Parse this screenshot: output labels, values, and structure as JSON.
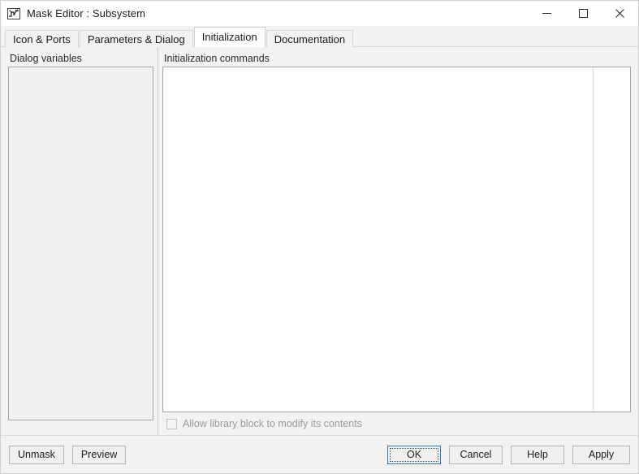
{
  "window": {
    "title": "Mask Editor : Subsystem",
    "icon": "simulink-mask-icon",
    "controls": {
      "minimize": "minimize-icon",
      "maximize": "maximize-icon",
      "close": "close-icon"
    }
  },
  "tabs": [
    {
      "label": "Icon & Ports",
      "active": false
    },
    {
      "label": "Parameters & Dialog",
      "active": false
    },
    {
      "label": "Initialization",
      "active": true
    },
    {
      "label": "Documentation",
      "active": false
    }
  ],
  "panes": {
    "left": {
      "label": "Dialog variables",
      "items": []
    },
    "right": {
      "label": "Initialization commands",
      "editor_value": "",
      "editor_placeholder": "",
      "checkbox": {
        "label": "Allow library block to modify its contents",
        "checked": false,
        "enabled": false
      }
    }
  },
  "footer": {
    "left_buttons": [
      {
        "label": "Unmask"
      },
      {
        "label": "Preview"
      }
    ],
    "right_buttons": [
      {
        "label": "OK",
        "default": true
      },
      {
        "label": "Cancel",
        "default": false
      },
      {
        "label": "Help",
        "default": false
      },
      {
        "label": "Apply",
        "default": false
      }
    ]
  },
  "colors": {
    "window_bg": "#f2f2f2",
    "titlebar_bg": "#ffffff",
    "editor_bg": "#ffffff",
    "listbox_bg": "#f0f0f0",
    "accent_focus": "#2a7ab9",
    "border": "#a5a5a5",
    "disabled_text": "#9a9a9a"
  }
}
